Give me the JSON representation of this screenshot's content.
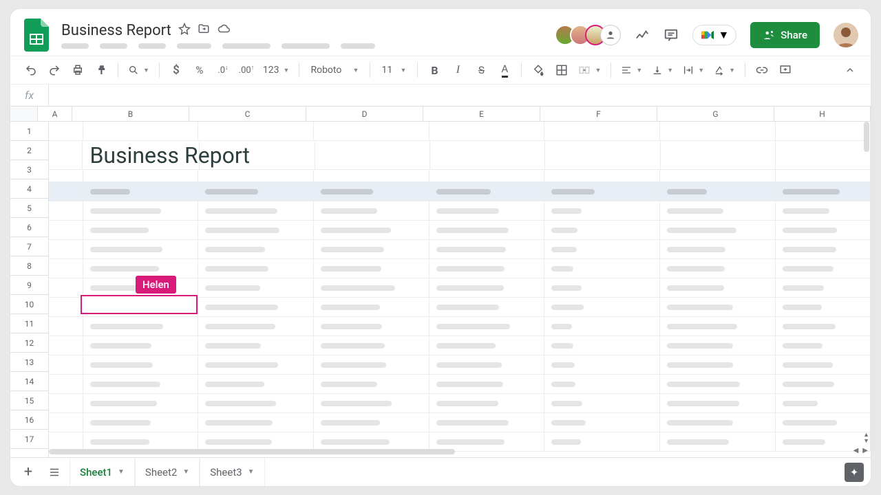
{
  "doc": {
    "title": "Business Report",
    "share_label": "Share"
  },
  "toolbar": {
    "font": "Roboto",
    "font_size": "11",
    "number_format": "123",
    "decrease_dec": ".0",
    "increase_dec": ".00"
  },
  "fx": {
    "label": "fx"
  },
  "columns": [
    {
      "id": "A",
      "w": 50
    },
    {
      "id": "B",
      "w": 170
    },
    {
      "id": "C",
      "w": 170
    },
    {
      "id": "D",
      "w": 170
    },
    {
      "id": "E",
      "w": 170
    },
    {
      "id": "F",
      "w": 170
    },
    {
      "id": "G",
      "w": 170
    },
    {
      "id": "H",
      "w": 140
    }
  ],
  "rows": [
    "1",
    "2",
    "3",
    "4",
    "5",
    "6",
    "7",
    "8",
    "9",
    "10",
    "11",
    "12",
    "13",
    "14",
    "15",
    "16",
    "17"
  ],
  "sheet": {
    "title_cell": "Business Report"
  },
  "collab": {
    "name": "Helen"
  },
  "tabs": [
    {
      "label": "Sheet1",
      "active": true
    },
    {
      "label": "Sheet2",
      "active": false
    },
    {
      "label": "Sheet3",
      "active": false
    }
  ],
  "colors": {
    "share_bg": "#1e8e3e",
    "collab": "#d81b7a"
  }
}
